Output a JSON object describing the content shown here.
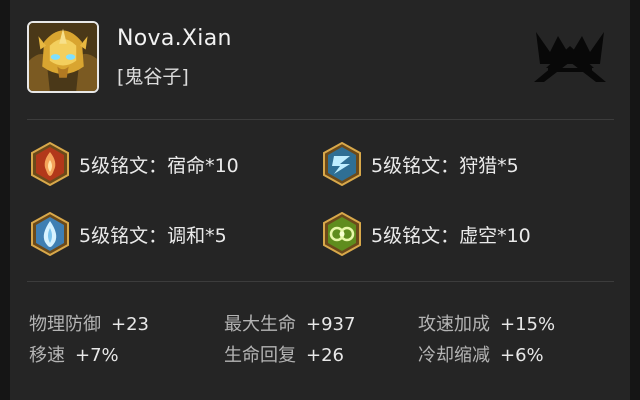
{
  "player": {
    "name": "Nova.Xian",
    "hero": "[鬼谷子]",
    "avatar_icon": "hero-portrait-golden-helmet",
    "rank_icon": "crown-rank-emblem"
  },
  "runes": [
    {
      "label": "5级铭文：宿命*10",
      "icon": "rune-red-flame",
      "color": "#c8451f"
    },
    {
      "label": "5级铭文：狩猎*5",
      "icon": "rune-blue-lightning",
      "color": "#3d82a8"
    },
    {
      "label": "5级铭文：调和*5",
      "icon": "rune-blue-droplet",
      "color": "#4b8ec1"
    },
    {
      "label": "5级铭文：虚空*10",
      "icon": "rune-green-swirl",
      "color": "#7fae2e"
    }
  ],
  "stats": [
    {
      "label": "物理防御",
      "value": "+23"
    },
    {
      "label": "最大生命",
      "value": "+937"
    },
    {
      "label": "攻速加成",
      "value": "+15%"
    },
    {
      "label": "移速",
      "value": "+7%"
    },
    {
      "label": "生命回复",
      "value": "+26"
    },
    {
      "label": "冷却缩减",
      "value": "+6%"
    }
  ],
  "colors": {
    "background": "#252525",
    "text": "#e6e6e6",
    "label": "#b4b4b4"
  }
}
